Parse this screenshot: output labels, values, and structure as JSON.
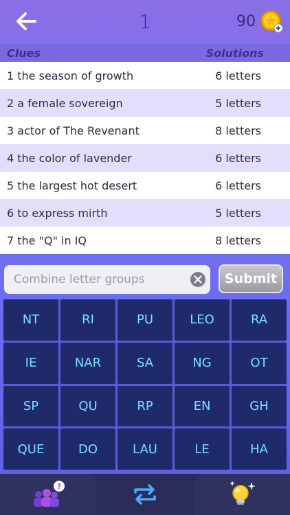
{
  "header": {
    "level": "1",
    "coins": "90",
    "back_icon": "arrow-left-icon",
    "coin_icon": "coin-plus-icon"
  },
  "table": {
    "col_clues": "Clues",
    "col_solutions": "Solutions",
    "rows": [
      {
        "clue": "1  the season of growth",
        "solution": "6 letters"
      },
      {
        "clue": "2 a female sovereign",
        "solution": "5 letters"
      },
      {
        "clue": "3 actor of The Revenant",
        "solution": "8 letters"
      },
      {
        "clue": "4 the color of lavender",
        "solution": "6 letters"
      },
      {
        "clue": "5 the largest hot desert",
        "solution": "6 letters"
      },
      {
        "clue": "6 to express mirth",
        "solution": "5 letters"
      },
      {
        "clue": "7 the \"Q\" in IQ",
        "solution": "8 letters"
      }
    ]
  },
  "input": {
    "placeholder": "Combine letter groups",
    "value": ""
  },
  "submit_label": "Submit",
  "tiles": [
    "NT",
    "RI",
    "PU",
    "LEO",
    "RA",
    "IE",
    "NAR",
    "SA",
    "NG",
    "OT",
    "SP",
    "QU",
    "RP",
    "EN",
    "GH",
    "QUE",
    "DO",
    "LAU",
    "LE",
    "HA"
  ],
  "bottom_tabs": [
    {
      "icon": "friends-help-icon"
    },
    {
      "icon": "shuffle-icon"
    },
    {
      "icon": "lightbulb-hint-icon"
    }
  ],
  "colors": {
    "tile_bg": "#1f2a6b",
    "tile_text": "#7be0ff",
    "accent": "#f5b400"
  }
}
